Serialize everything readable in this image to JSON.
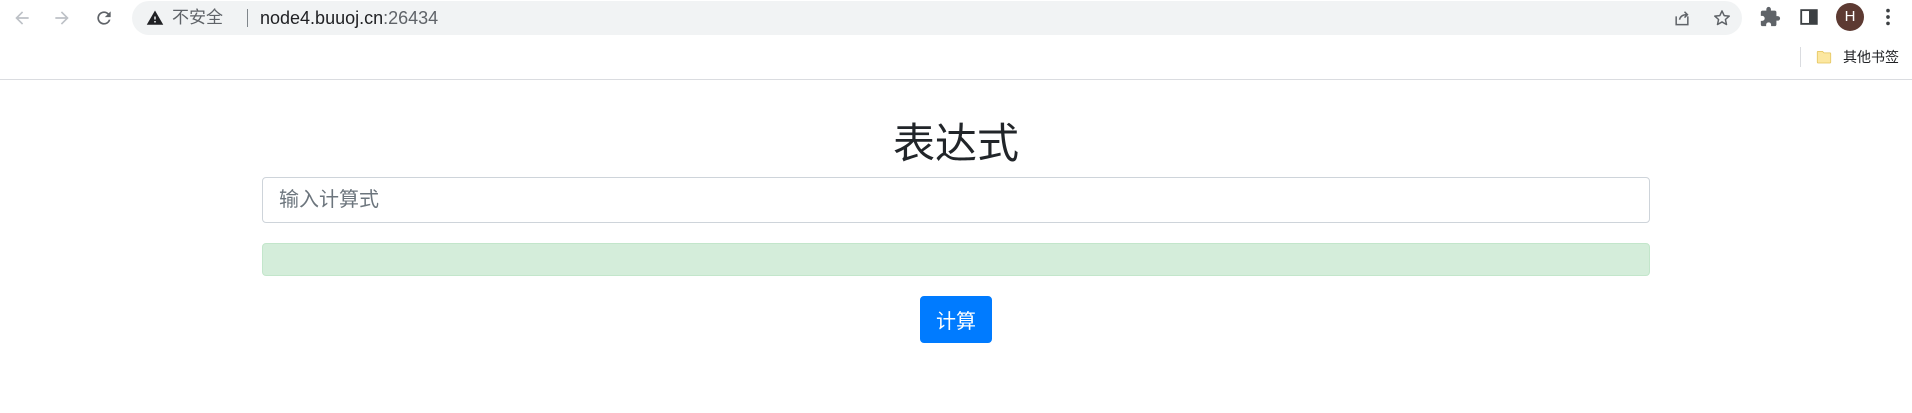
{
  "browser": {
    "security_label": "不安全",
    "url_host": "node4.buuoj.cn",
    "url_port": ":26434",
    "avatar_initial": "H",
    "bookmarks": {
      "other_bookmarks_label": "其他书签"
    },
    "icons": {
      "back": "arrow-left-icon",
      "forward": "arrow-right-icon",
      "reload": "reload-icon",
      "warning": "warning-triangle-icon",
      "share": "share-icon",
      "star": "star-icon",
      "extensions": "puzzle-piece-icon",
      "side_panel": "side-panel-icon",
      "menu": "kebab-menu-icon",
      "folder": "folder-icon"
    }
  },
  "page": {
    "title": "表达式",
    "input": {
      "placeholder": "输入计算式",
      "value": ""
    },
    "result": {
      "text": ""
    },
    "submit_label": "计算"
  },
  "colors": {
    "primary": "#007bff",
    "alert_success_bg": "#d4edda",
    "alert_success_border": "#c3e6cb",
    "avatar_bg": "#5d3a32"
  }
}
